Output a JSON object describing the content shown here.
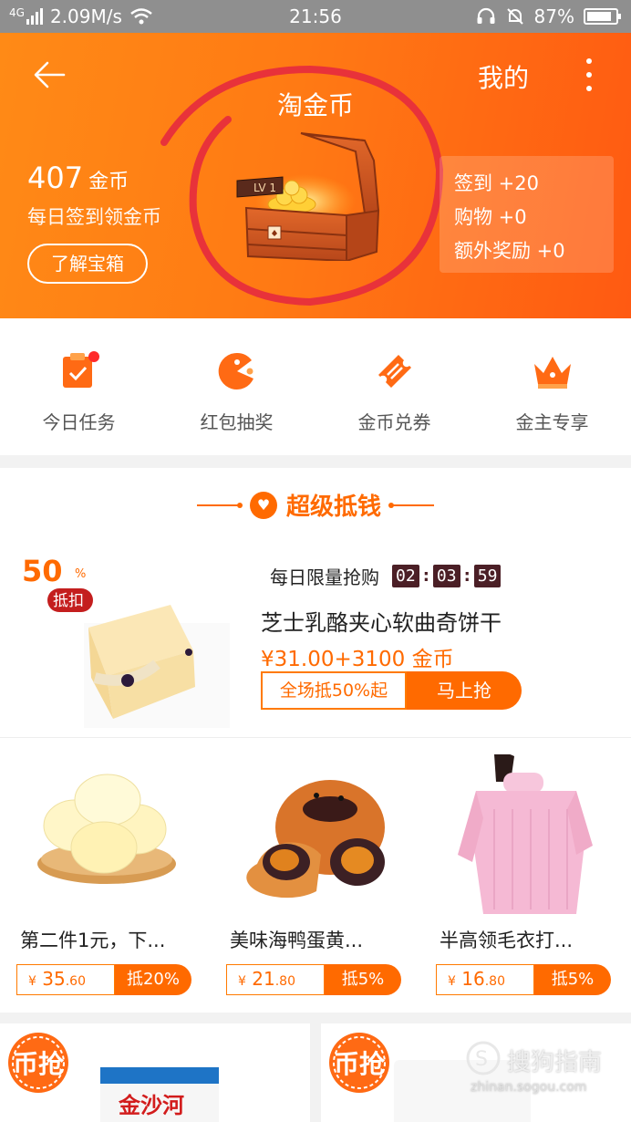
{
  "status_bar": {
    "network": "4G",
    "speed": "2.09M/s",
    "time": "21:56",
    "battery": "87%",
    "battery_level": 0.87
  },
  "header": {
    "title": "淘金币",
    "mine_label": "我的",
    "chest_level": "LV 1",
    "coins_count": "407",
    "coins_unit": "金币",
    "daily_text": "每日签到领金币",
    "learn_button": "了解宝箱",
    "rewards": [
      "签到 +20",
      "购物 +0",
      "额外奖励 +0"
    ],
    "accent_color": "#ff7a14",
    "annotation_color": "#e8323a"
  },
  "shortcuts": [
    {
      "label": "今日任务",
      "icon": "task-clipboard-icon"
    },
    {
      "label": "红包抽奖",
      "icon": "lottery-pacman-icon"
    },
    {
      "label": "金币兑券",
      "icon": "coupon-ticket-icon"
    },
    {
      "label": "金主专享",
      "icon": "crown-icon"
    }
  ],
  "super_deal": {
    "title": "超级抵钱",
    "badge_percent": "50",
    "badge_pct_sign": "%",
    "badge_text": "抵扣",
    "limit_label": "每日限量抢购",
    "timer": [
      "02",
      "03",
      "59"
    ],
    "product_name": "芝士乳酪夹心软曲奇饼干",
    "price": "¥31.00+3100 金币",
    "promo": "全场抵50%起",
    "buy_button": "马上抢"
  },
  "products": [
    {
      "name": "第二件1元，下...",
      "price_currency": "¥",
      "price_int": "35",
      "price_dec": ".60",
      "discount": "抵20%"
    },
    {
      "name": "美味海鸭蛋黄...",
      "price_currency": "¥",
      "price_int": "21",
      "price_dec": ".80",
      "discount": "抵5%"
    },
    {
      "name": "半高领毛衣打...",
      "price_currency": "¥",
      "price_int": "16",
      "price_dec": ".80",
      "discount": "抵5%"
    }
  ],
  "bottom_cards": [
    {
      "badge": "币抢",
      "brand_text": "金沙河"
    },
    {
      "badge": "币抢"
    }
  ],
  "watermark": {
    "brand": "搜狗指南",
    "url": "zhinan.sogou.com"
  }
}
